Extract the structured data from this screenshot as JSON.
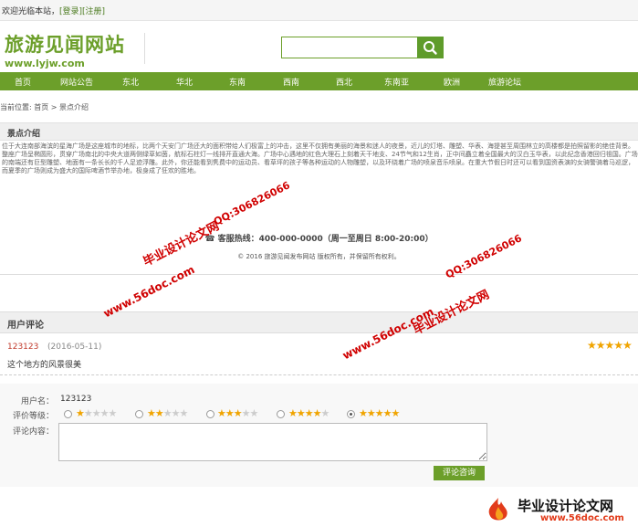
{
  "topbar": {
    "welcome": "欢迎光临本站，",
    "login": "[登录]",
    "register": "[注册]"
  },
  "logo": {
    "title": "旅游见闻网站",
    "url": "www.lyjw.com"
  },
  "search": {
    "placeholder": ""
  },
  "nav": {
    "items": [
      "首页",
      "网站公告",
      "东北",
      "华北",
      "东南",
      "西南",
      "西北",
      "东南亚",
      "欧洲",
      "旅游论坛"
    ]
  },
  "breadcrumb": "当前位置: 首页 > 景点介绍",
  "section": {
    "title": "景点介绍"
  },
  "intro": {
    "text": "位于大连南部海滨的星海广场是这座城市的地标，比两个天安门广场还大的面积带给人们极富上的冲击，这里不仅拥有美丽的海景和迷人的夜景，近儿的灯塔、雕塑、华表、海提甚至周围林立的高楼都是拍照留影的绝佳背景。整座广场呈椭圆形，贯穿广场南北的中央大道两侧绿草如茵，航标石柱灯一线排开直通大海。广场中心遇地的红色大理石上刻着天干地支、24节气和12生肖，正中间矗立着全国最大的汉白玉华表，以此纪念香港回归祖国。广场的南端还有巨型雕塑、地面有一条长长的千人足迹浮雕。此外，你还能看到隽费中的运动员、看草坪的孩子等各种运动的人物雕塑，以及环绕着广场的喷泉音乐喷泉。在重大节假日时还可以看到国资表演的女骑警骑着马巡逻，而夏季的广场则成为盛大的国际啤酒节举办地，极身成了狂欢的胜地。"
  },
  "hotline": "☎ 客服热线：400-000-0000（周一至周日 8:00-20:00）",
  "copyright": "© 2016 旅游见闻发布网站 版权所有，并保留所有权利。",
  "reviews": {
    "title": "用户评论",
    "items": [
      {
        "user": "123123",
        "date": "(2016-05-11)",
        "rating": 5,
        "text": "这个地方的风景很美"
      }
    ]
  },
  "form": {
    "username_label": "用户名：",
    "username": "123123",
    "rating_label": "评价等级：",
    "content_label": "评论内容：",
    "selected_rating": 5,
    "submit": "评论咨询"
  },
  "watermarks": {
    "w1": "毕业设计论文网",
    "w2": "QQ:306826066",
    "w3": "www.56doc.com",
    "w4": "www.56doc.com",
    "w5": "QQ:306826066",
    "w6": "毕业设计论文网",
    "footer_cn": "毕业设计论文网",
    "footer_url": "www.56doc.com"
  },
  "colors": {
    "brand": "#6c9f2a",
    "star": "#f0a400",
    "watermark": "#d00000"
  }
}
